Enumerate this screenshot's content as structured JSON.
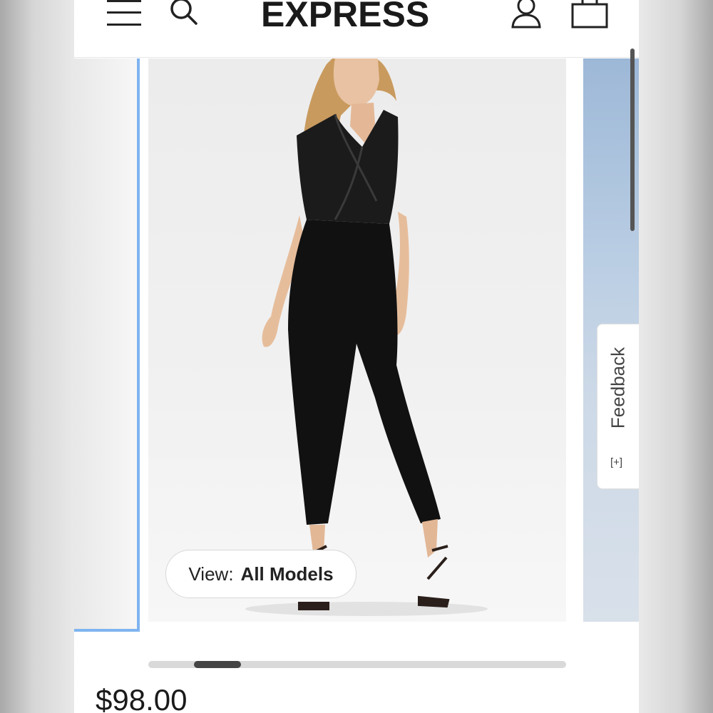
{
  "header": {
    "logo": "EXPRESS",
    "icons": [
      "menu-icon",
      "search-icon",
      "account-icon",
      "shopping-bag-icon"
    ]
  },
  "carousel": {
    "view_prefix": "View:",
    "view_value": "All Models",
    "scroll_progress": 0.19
  },
  "feedback": {
    "label": "Feedback",
    "icon": "[+]"
  },
  "product": {
    "price": "$98.00"
  },
  "colors": {
    "accent_border": "#7fb4f0",
    "brand_text": "#1a1a1a"
  }
}
